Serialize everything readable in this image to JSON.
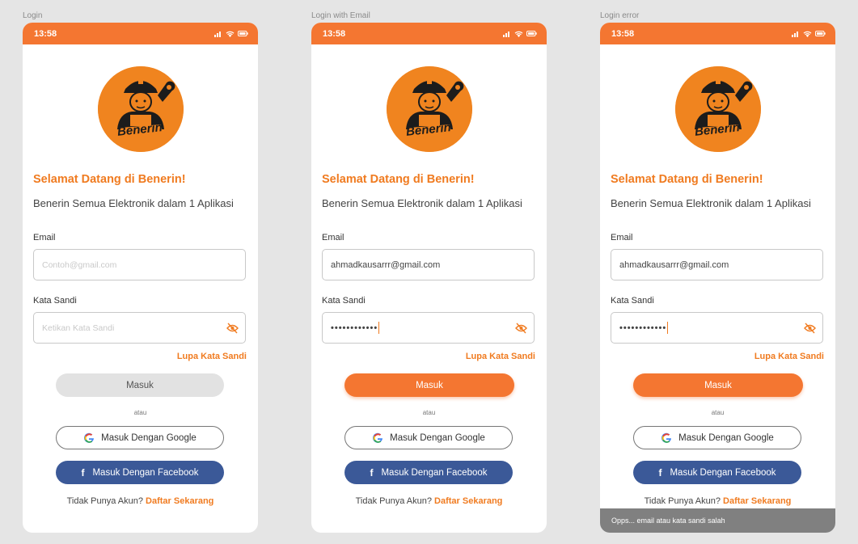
{
  "status_time": "13:58",
  "brand_logo_text": "Benerin",
  "common": {
    "title": "Selamat Datang di Benerin!",
    "subtitle": "Benerin Semua Elektronik dalam 1 Aplikasi",
    "email_label": "Email",
    "password_label": "Kata Sandi",
    "email_placeholder": "Contoh@gmail.com",
    "password_placeholder": "Ketikan Kata Sandi",
    "forgot_label": "Lupa Kata Sandi",
    "login_label": "Masuk",
    "or_label": "atau",
    "google_label": "Masuk Dengan Google",
    "facebook_label": "Masuk Dengan Facebook",
    "signup_prompt": "Tidak Punya Akun?",
    "signup_link": "Daftar Sekarang"
  },
  "screens": [
    {
      "frame_label": "Login",
      "email_value": "",
      "password_value": "",
      "login_enabled": false,
      "toast": ""
    },
    {
      "frame_label": "Login with Email",
      "email_value": "ahmadkausarrr@gmail.com",
      "password_value": "••••••••••••",
      "login_enabled": true,
      "toast": ""
    },
    {
      "frame_label": "Login error",
      "email_value": "ahmadkausarrr@gmail.com",
      "password_value": "••••••••••••",
      "login_enabled": true,
      "toast": "Opps... email atau kata sandi salah"
    }
  ],
  "colors": {
    "brand_orange": "#f47631",
    "title_orange": "#f07b20",
    "facebook_blue": "#3b5998",
    "disabled_gray": "#e2e2e2",
    "toast_gray": "#808080"
  },
  "icons": [
    "signal-icon",
    "wifi-icon",
    "battery-icon",
    "eye-off-icon",
    "google-icon",
    "facebook-icon"
  ]
}
